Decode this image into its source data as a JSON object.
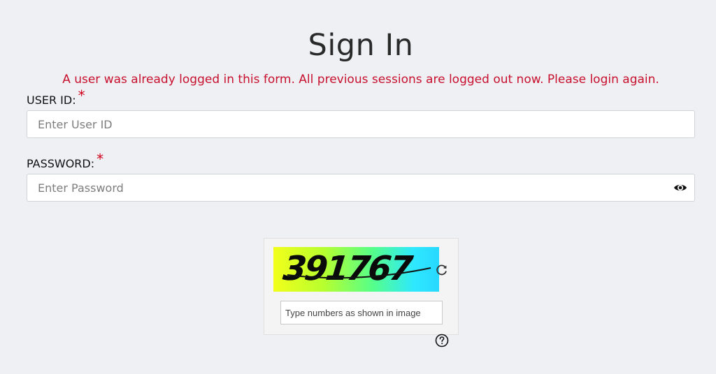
{
  "title": "Sign In",
  "error_message": "A user was already logged in this form. All previous sessions are logged out now. Please login again.",
  "user_id": {
    "label": "USER ID:",
    "required_mark": "*",
    "placeholder": "Enter User ID",
    "value": ""
  },
  "password": {
    "label": "PASSWORD:",
    "required_mark": "*",
    "placeholder": "Enter Password",
    "value": "",
    "toggle_icon": "eye-icon"
  },
  "captcha": {
    "code": "391767",
    "refresh_icon": "refresh-icon",
    "placeholder": "Type numbers as shown in image",
    "value": "",
    "help_icon": "question-circle-icon"
  },
  "colors": {
    "background": "#eef0f4",
    "error": "#c8102e",
    "required": "#d0021b"
  }
}
